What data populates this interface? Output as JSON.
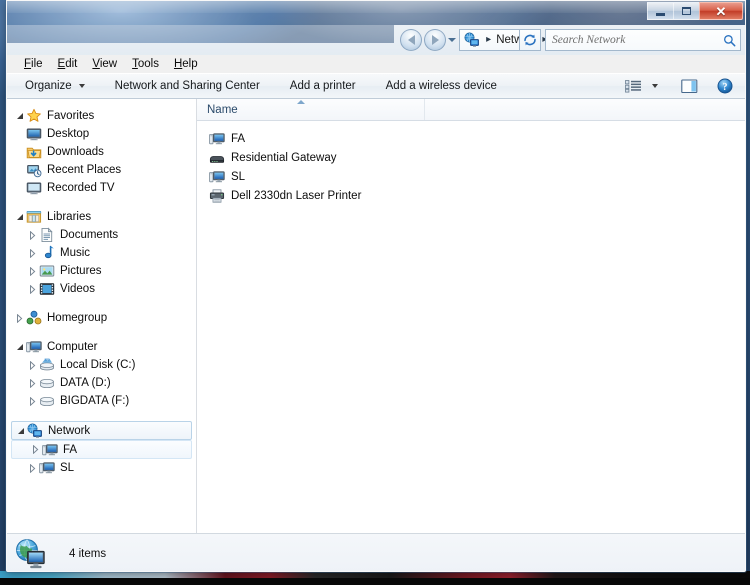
{
  "window": {
    "title": "",
    "controls": {
      "minimize": "Minimize",
      "maximize": "Maximize",
      "close": "✕"
    }
  },
  "addressbar": {
    "back_label": "Back",
    "forward_label": "Forward",
    "history_label": "Recent pages",
    "crumb_icon": "network-icon",
    "crumb_root": "Network",
    "crumb_sep1": "▸",
    "crumb_sep2": "▸",
    "dropdown_label": "▾",
    "refresh_label": "Refresh",
    "search_placeholder": "Search Network",
    "search_value": ""
  },
  "menubar": {
    "items": [
      {
        "label": "File",
        "accel": "F",
        "rest": "ile"
      },
      {
        "label": "Edit",
        "accel": "E",
        "rest": "dit"
      },
      {
        "label": "View",
        "accel": "V",
        "rest": "iew"
      },
      {
        "label": "Tools",
        "accel": "T",
        "rest": "ools"
      },
      {
        "label": "Help",
        "accel": "H",
        "rest": "elp"
      }
    ]
  },
  "toolbar": {
    "organize": "Organize",
    "network_sharing": "Network and Sharing Center",
    "add_printer": "Add a printer",
    "add_wireless": "Add a wireless device",
    "view_options_label": "Change your view",
    "preview_pane_label": "Show the preview pane",
    "help_label": "Get help"
  },
  "navpane": {
    "groups": [
      {
        "header": {
          "label": "Favorites",
          "icon": "star-icon",
          "expanded": true
        },
        "items": [
          {
            "label": "Desktop",
            "icon": "desktop-icon",
            "expander": "none"
          },
          {
            "label": "Downloads",
            "icon": "downloads-icon",
            "expander": "none"
          },
          {
            "label": "Recent Places",
            "icon": "recent-places-icon",
            "expander": "none"
          },
          {
            "label": "Recorded TV",
            "icon": "recorded-tv-icon",
            "expander": "none"
          }
        ]
      },
      {
        "header": {
          "label": "Libraries",
          "icon": "libraries-icon",
          "expanded": true
        },
        "items": [
          {
            "label": "Documents",
            "icon": "documents-icon",
            "expander": "closed"
          },
          {
            "label": "Music",
            "icon": "music-icon",
            "expander": "closed"
          },
          {
            "label": "Pictures",
            "icon": "pictures-icon",
            "expander": "closed"
          },
          {
            "label": "Videos",
            "icon": "videos-icon",
            "expander": "closed"
          }
        ]
      },
      {
        "header": {
          "label": "Homegroup",
          "icon": "homegroup-icon",
          "expanded": false
        },
        "items": []
      },
      {
        "header": {
          "label": "Computer",
          "icon": "computer-icon",
          "expanded": true
        },
        "items": [
          {
            "label": "Local Disk (C:)",
            "icon": "system-drive-icon",
            "expander": "closed"
          },
          {
            "label": "DATA (D:)",
            "icon": "drive-icon",
            "expander": "closed"
          },
          {
            "label": "BIGDATA (F:)",
            "icon": "drive-icon",
            "expander": "closed"
          }
        ]
      },
      {
        "header": {
          "label": "Network",
          "icon": "network-icon",
          "expanded": true,
          "selected": true
        },
        "items": [
          {
            "label": "FA",
            "icon": "computer-icon",
            "expander": "closed",
            "hover": true
          },
          {
            "label": "SL",
            "icon": "computer-icon",
            "expander": "closed"
          }
        ]
      }
    ]
  },
  "content": {
    "columns": [
      {
        "label": "Name",
        "sorted": "asc"
      },
      {
        "label": ""
      }
    ],
    "items": [
      {
        "name": "FA",
        "icon": "computer-icon"
      },
      {
        "name": "Residential Gateway",
        "icon": "gateway-icon"
      },
      {
        "name": "SL",
        "icon": "computer-icon"
      },
      {
        "name": "Dell 2330dn Laser Printer",
        "icon": "printer-icon"
      }
    ]
  },
  "statusbar": {
    "icon": "network-globe-icon",
    "text": "4 items"
  },
  "colors": {
    "accent": "#2a6099",
    "selection": "#b9d3e8",
    "close_button": "#c23c28",
    "header_text": "#2a4a6a"
  }
}
